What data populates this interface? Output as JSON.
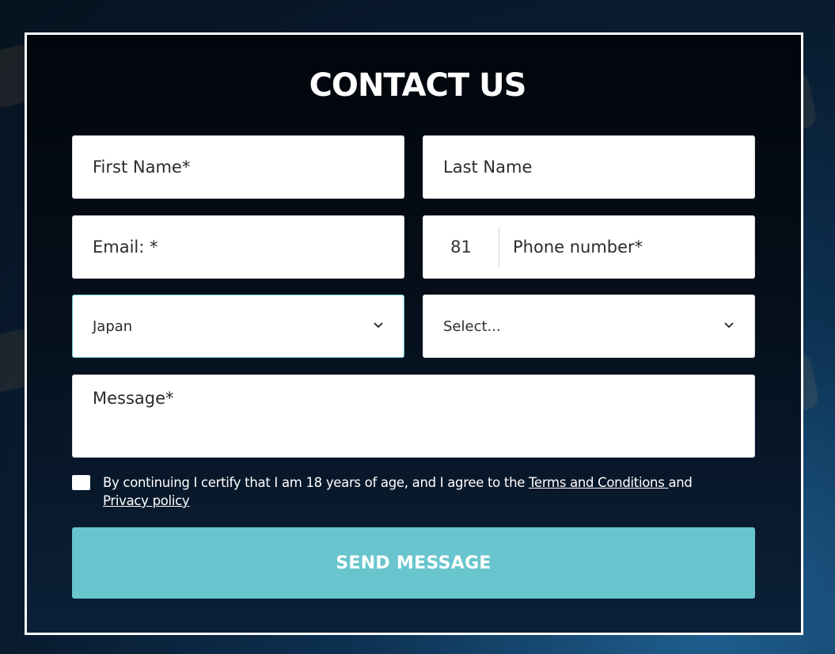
{
  "page": {
    "title": "CONTACT US"
  },
  "form": {
    "first_name_placeholder": "First Name*",
    "last_name_placeholder": "Last Name",
    "email_placeholder": "Email: *",
    "phone_code": "81",
    "phone_placeholder": "Phone number*",
    "country_selected": "Japan",
    "second_select_placeholder": "Select...",
    "message_placeholder": "Message*"
  },
  "consent": {
    "text_before": "By continuing I certify that I am 18 years of age, and I agree to the ",
    "terms_link": "Terms and Conditions ",
    "text_middle": "and ",
    "privacy_link": "Privacy policy",
    "checked": false
  },
  "submit": {
    "label": "SEND MESSAGE"
  },
  "colors": {
    "accent": "#68c5cd",
    "background": "#081a2e",
    "frame_border": "#ffffff"
  }
}
